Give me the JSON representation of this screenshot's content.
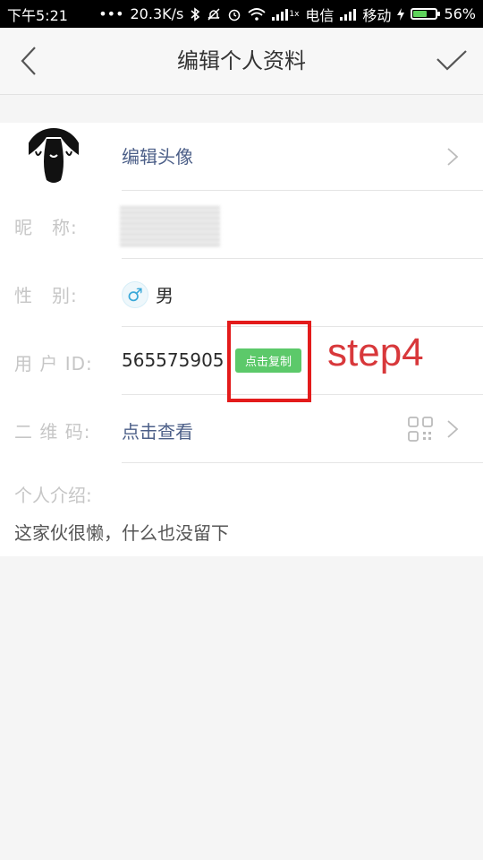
{
  "status_bar": {
    "time": "下午5:21",
    "dots": "•••",
    "network_speed": "20.3K/s",
    "carrier1": "电信",
    "carrier2": "移动",
    "battery_percent": "56%",
    "battery_level": 0.56,
    "signal_label": "1x"
  },
  "header": {
    "title": "编辑个人资料"
  },
  "profile": {
    "avatar_label": "编辑头像",
    "nickname_label": "昵　称:",
    "gender_label": "性　别:",
    "gender_symbol": "♂",
    "gender_value": "男",
    "user_id_label": "用 户 ID:",
    "user_id_value": "565575905",
    "copy_button_label": "点击复制",
    "qr_label": "二 维 码:",
    "qr_value": "点击查看",
    "intro_label": "个人介绍:",
    "intro_text": "这家伙很懒，什么也没留下"
  },
  "annotation": {
    "step_text": "step4",
    "color": "#e31b1b"
  },
  "colors": {
    "accent_green": "#5cc96a",
    "link_blue": "#4c5f88",
    "gender_blue": "#3aa8d8"
  }
}
